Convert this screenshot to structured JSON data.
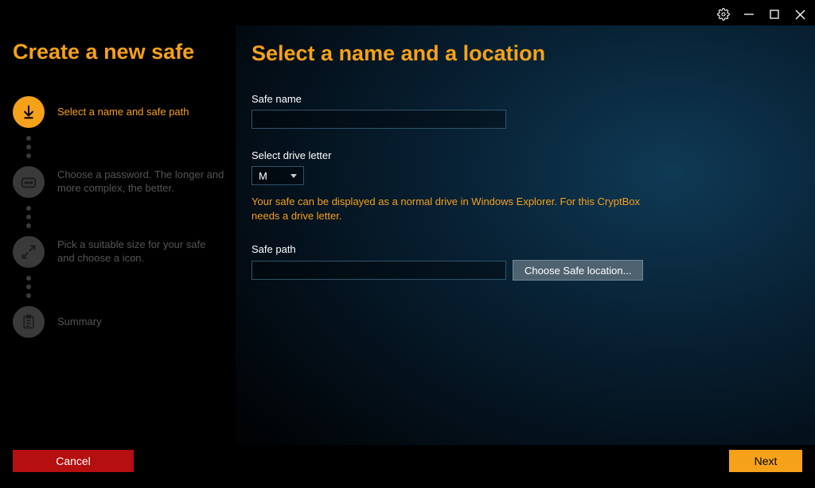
{
  "window_controls": {
    "settings": "settings",
    "minimize": "minimize",
    "maximize": "maximize",
    "close": "close"
  },
  "sidebar": {
    "title": "Create a new safe",
    "steps": [
      {
        "label": "Select a name and safe path",
        "icon": "download",
        "active": true
      },
      {
        "label": "Choose a password. The longer and more complex, the better.",
        "icon": "password",
        "active": false
      },
      {
        "label": "Pick a suitable size for your safe and choose a icon.",
        "icon": "resize",
        "active": false
      },
      {
        "label": "Summary",
        "icon": "clipboard",
        "active": false
      }
    ]
  },
  "main": {
    "heading": "Select a name and a location",
    "safe_name_label": "Safe name",
    "safe_name_value": "",
    "drive_letter_label": "Select drive letter",
    "drive_letter_value": "M",
    "drive_help": "Your safe can be displayed as a normal drive in Windows Explorer. For this CryptBox needs a drive letter.",
    "safe_path_label": "Safe path",
    "safe_path_value": "",
    "choose_location_label": "Choose Safe location..."
  },
  "footer": {
    "cancel": "Cancel",
    "next": "Next"
  }
}
